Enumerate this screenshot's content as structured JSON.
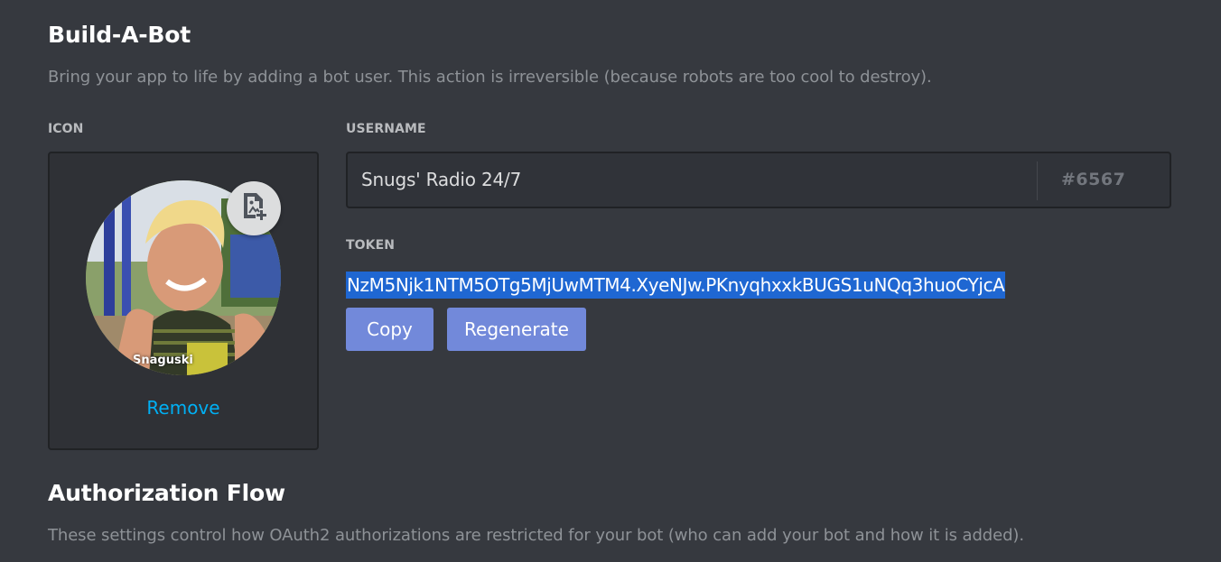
{
  "build_a_bot": {
    "title": "Build-A-Bot",
    "description": "Bring your app to life by adding a bot user. This action is irreversible (because robots are too cool to destroy)."
  },
  "icon_section": {
    "label": "ICON",
    "avatar_caption": "Snaguski",
    "upload_icon": "image-add-icon",
    "remove_label": "Remove"
  },
  "username_section": {
    "label": "USERNAME",
    "value": "Snugs' Radio 24/7",
    "discriminator": "#6567"
  },
  "token_section": {
    "label": "TOKEN",
    "value": "NzM5Njk1NTM5OTg5MjUwMTM4.XyeNJw.PKnyqhxxkBUGS1uNQq3huoCYjcA",
    "copy_label": "Copy",
    "regenerate_label": "Regenerate"
  },
  "authorization_flow": {
    "title": "Authorization Flow",
    "description": "These settings control how OAuth2 authorizations are restricted for your bot (who can add your bot and how it is added)."
  },
  "colors": {
    "background": "#36393f",
    "button": "#7289da",
    "link": "#00b0f4",
    "selection": "#1f67d2"
  }
}
